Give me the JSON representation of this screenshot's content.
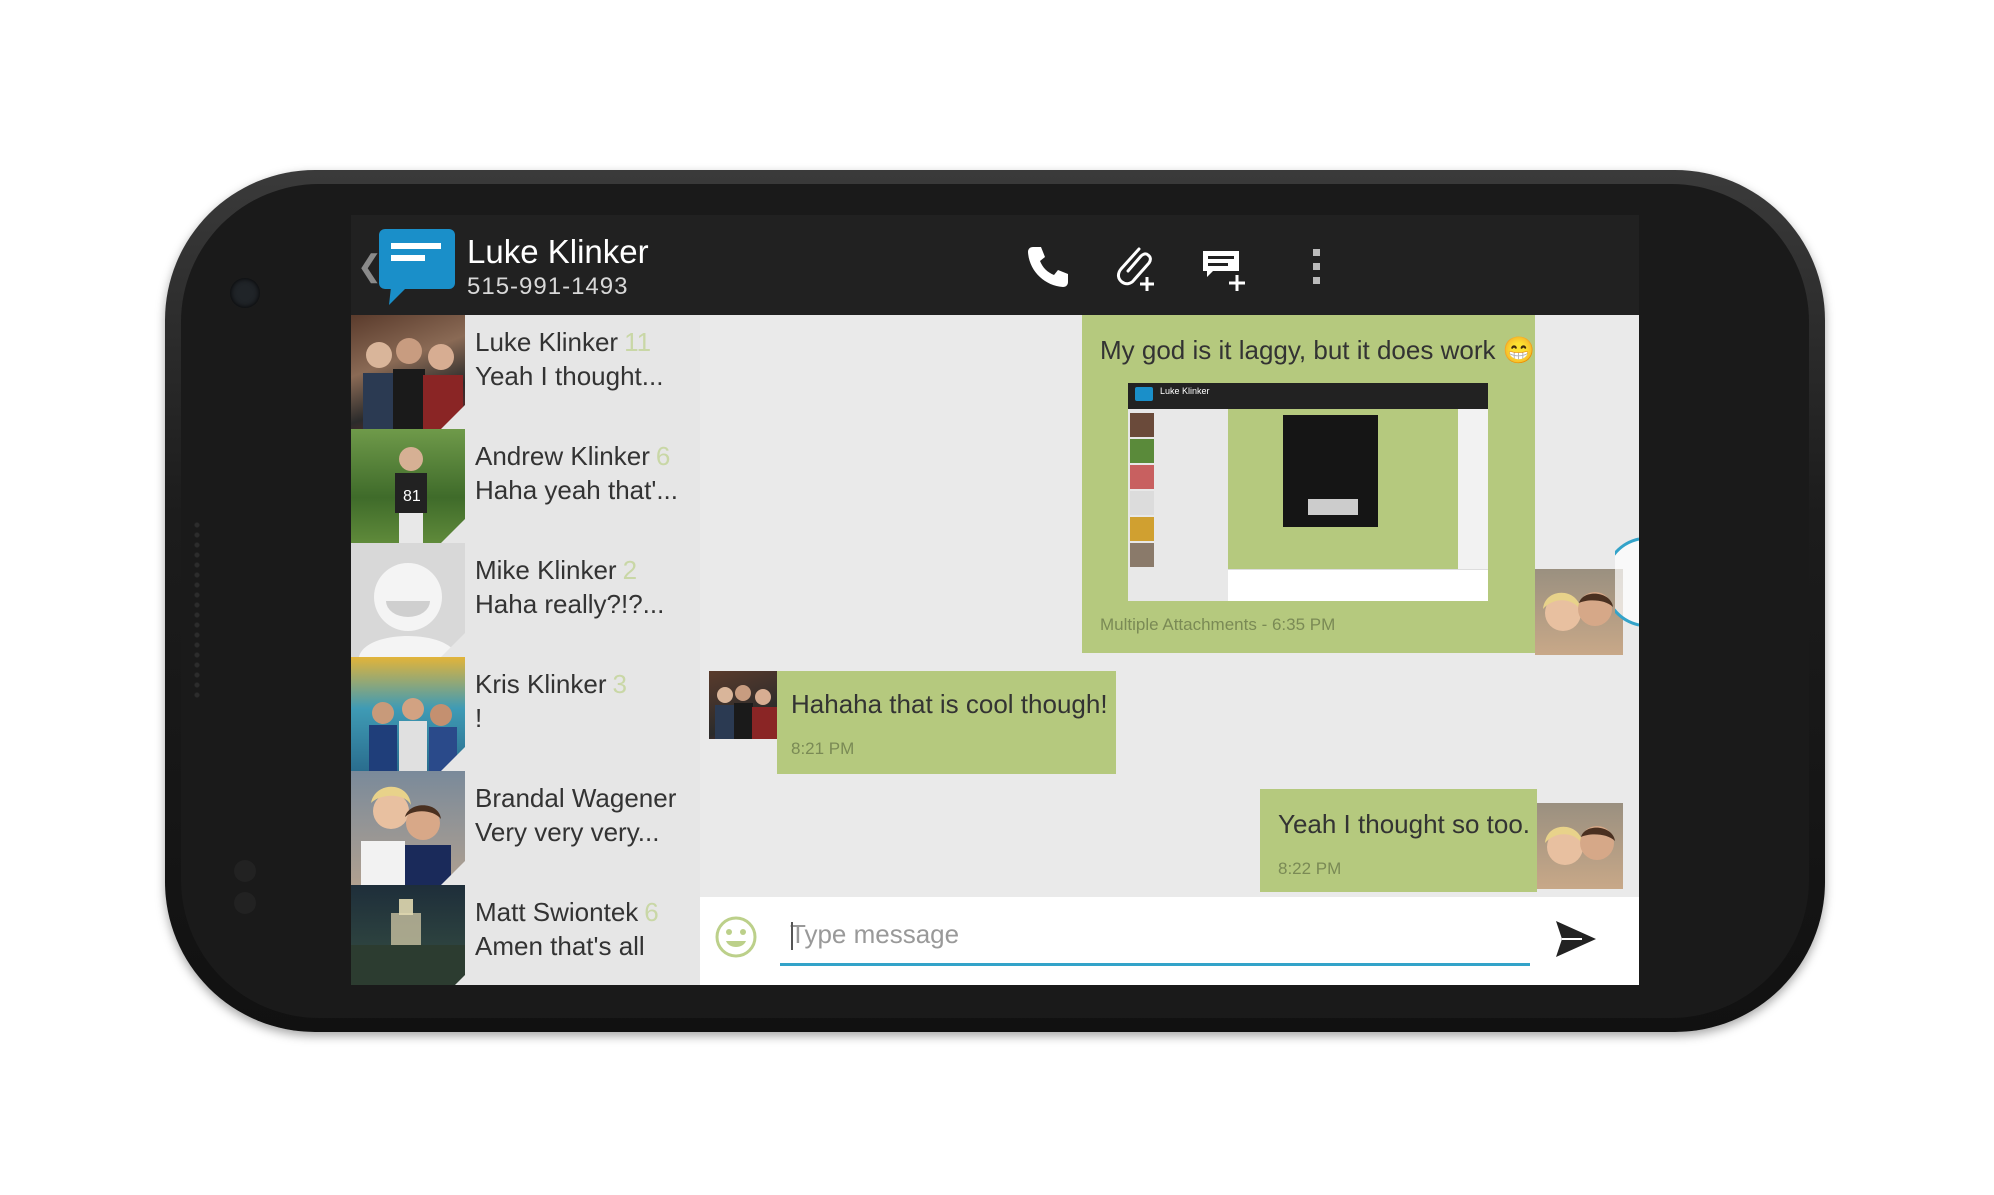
{
  "header": {
    "contact_name": "Luke Klinker",
    "contact_phone": "515-991-1493",
    "actions": [
      "call-icon",
      "attach-icon",
      "template-icon",
      "overflow-icon"
    ]
  },
  "conversations": [
    {
      "name": "Luke Klinker",
      "count": "11",
      "snippet": "Yeah I thought..."
    },
    {
      "name": "Andrew Klinker",
      "count": "6",
      "snippet": "Haha yeah that'..."
    },
    {
      "name": "Mike Klinker",
      "count": "2",
      "snippet": "Haha really?!?..."
    },
    {
      "name": "Kris Klinker",
      "count": "3",
      "snippet": "!"
    },
    {
      "name": "Brandal Wagener",
      "count": "",
      "snippet": "Very very very..."
    },
    {
      "name": "Matt Swiontek",
      "count": "6",
      "snippet": "Amen that's all"
    }
  ],
  "messages": [
    {
      "text": "My god is it laggy, but it does work 😁",
      "meta": "Multiple Attachments - 6:35 PM",
      "direction": "outgoing"
    },
    {
      "text": "Hahaha that is cool though!",
      "meta": "8:21 PM",
      "direction": "incoming"
    },
    {
      "text": "Yeah I thought so too.",
      "meta": "8:22 PM",
      "direction": "outgoing"
    }
  ],
  "attachment_preview": {
    "title": "Luke Klinker"
  },
  "compose": {
    "placeholder": "Type message"
  },
  "colors": {
    "bubble": "#b5c97e",
    "topbar": "#212121",
    "accent": "#33a3c9",
    "count": "#c9d7a6"
  }
}
